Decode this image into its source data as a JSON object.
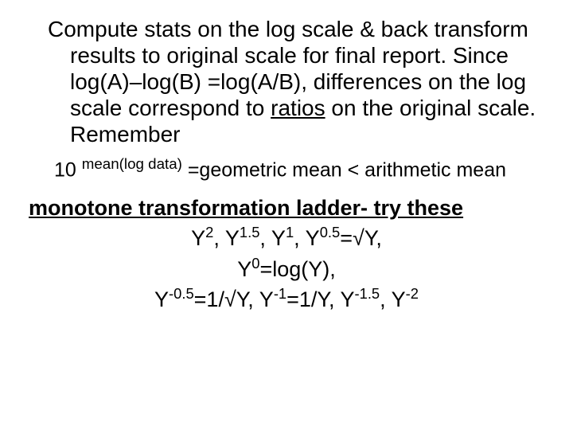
{
  "para1_a": "Compute stats on the log scale & back transform results to original scale for final report. Since log(A)–log(B) =log(A/B), differences on the log scale correspond to ",
  "para1_ratios": "ratios",
  "para1_b": " on the original scale. Remember",
  "f1_base": "10 ",
  "f1_exp": "mean(log data)",
  "f1_rest": " =geometric mean < arithmetic mean",
  "heading2": "monotone transformation ladder- try these",
  "l1_a": "Y",
  "l1_e1": "2",
  "l1_b": ", Y",
  "l1_e2": "1.5",
  "l1_c": ", Y",
  "l1_e3": "1",
  "l1_d": ", Y",
  "l1_e4": "0.5",
  "l1_e": "=√Y,",
  "l2_a": "Y",
  "l2_e1": "0",
  "l2_b": "=log(Y),",
  "l3_a": "Y",
  "l3_e1": "-0.5",
  "l3_b": "=1/√Y, Y",
  "l3_e2": "-1",
  "l3_c": "=1/Y,",
  "l3_cgap": " Y",
  "l3_e3": "-1.5",
  "l3_d": ", Y",
  "l3_e4": "-2"
}
